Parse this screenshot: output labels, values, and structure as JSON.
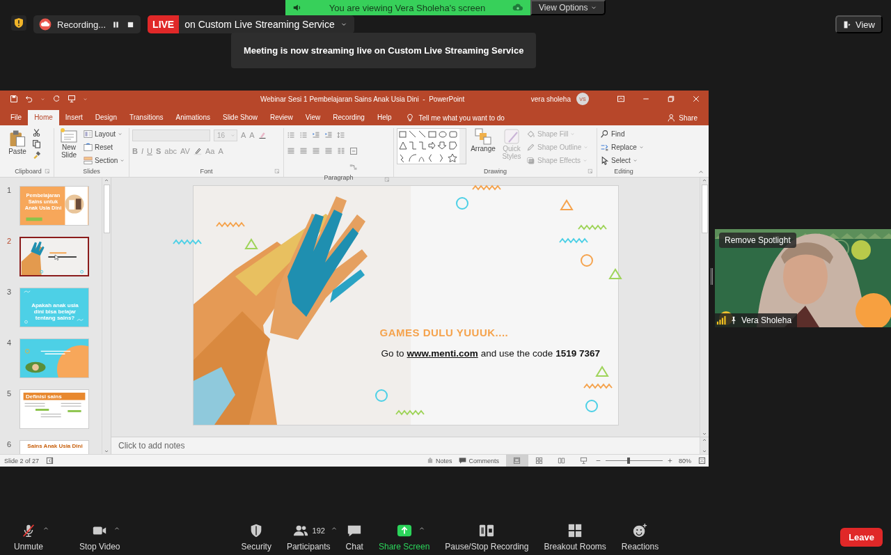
{
  "top_bar": {
    "recording": "Recording...",
    "live_badge": "LIVE",
    "live_service": "on Custom Live Streaming Service",
    "view_button": "View"
  },
  "share_banner": {
    "text": "You are viewing Vera Sholeha's screen",
    "view_options": "View Options"
  },
  "toast": "Meeting is now streaming live on Custom Live Streaming Service",
  "powerpoint": {
    "title": "Webinar Sesi 1 Pembelajaran Sains Anak Usia Dini  -  PowerPoint",
    "user_name": "vera sholeha",
    "user_initials": "VS",
    "tabs": [
      {
        "label": "File",
        "selected": false
      },
      {
        "label": "Home",
        "selected": true
      },
      {
        "label": "Insert",
        "selected": false
      },
      {
        "label": "Design",
        "selected": false
      },
      {
        "label": "Transitions",
        "selected": false
      },
      {
        "label": "Animations",
        "selected": false
      },
      {
        "label": "Slide Show",
        "selected": false
      },
      {
        "label": "Review",
        "selected": false
      },
      {
        "label": "View",
        "selected": false
      },
      {
        "label": "Recording",
        "selected": false
      },
      {
        "label": "Help",
        "selected": false
      }
    ],
    "tell_me": "Tell me what you want to do",
    "share": "Share",
    "ribbon": [
      {
        "kind": "clipboard",
        "label": "Clipboard",
        "paste": "Paste"
      },
      {
        "kind": "slides",
        "label": "Slides",
        "new_slide": "New Slide",
        "items": [
          "Layout",
          "Reset",
          "Section"
        ]
      },
      {
        "kind": "font",
        "label": "Font",
        "size": "16",
        "size_buttons": [
          "A",
          "A"
        ],
        "styles": [
          "B",
          "I",
          "U",
          "S",
          "abc",
          "AV",
          "Aa",
          "A"
        ]
      },
      {
        "kind": "paragraph",
        "label": "Paragraph"
      },
      {
        "kind": "drawing",
        "label": "Drawing",
        "arrange": "Arrange",
        "quick_styles": {
          "label": "Quick Styles",
          "disabled": true
        },
        "shape_items": [
          {
            "label": "Shape Fill",
            "disabled": true
          },
          {
            "label": "Shape Outline",
            "disabled": true
          },
          {
            "label": "Shape Effects",
            "disabled": true
          }
        ]
      },
      {
        "kind": "editing",
        "label": "Editing",
        "items": [
          "Find",
          "Replace",
          "Select"
        ]
      }
    ],
    "thumbnails": [
      {
        "number": "1",
        "kind": "orange",
        "title": "Pembelajaran Sains untuk Anak Usia Dini",
        "selected": false
      },
      {
        "number": "2",
        "kind": "hands",
        "selected": true
      },
      {
        "number": "3",
        "kind": "cyan",
        "title": "Apakah anak usia dini bisa belajar tentang sains?",
        "selected": false
      },
      {
        "number": "4",
        "kind": "cyan-orange",
        "selected": false
      },
      {
        "number": "5",
        "kind": "white-banner",
        "title": "Definisi sains",
        "selected": false
      },
      {
        "number": "6",
        "kind": "white",
        "title": "Sains Anak Usia Dini",
        "selected": false
      }
    ],
    "slide": {
      "heading": "GAMES DULU YUUUK....",
      "intro": "Go to",
      "link": "www.menti.com",
      "rest": "and use the code **1519 7367**"
    },
    "notes_placeholder": "Click to add notes",
    "status_bar": {
      "slide_position": "Slide 2 of 27",
      "notes": "Notes",
      "comments": "Comments",
      "views": [
        {
          "kind": "normal",
          "selected": true
        },
        {
          "kind": "sorter",
          "selected": false
        },
        {
          "kind": "reading",
          "selected": false
        },
        {
          "kind": "slideshow",
          "selected": false
        }
      ],
      "zoom_slider": {
        "level": 0.4
      },
      "zoom": "80%"
    }
  },
  "video_tile": {
    "spotlight_button": "Remove Spotlight",
    "name": "Vera Sholeha"
  },
  "toolbar": {
    "items": [
      {
        "kind": "mic",
        "label": "Unmute",
        "muted": true,
        "caret": true
      },
      {
        "kind": "video",
        "label": "Stop Video",
        "caret": true
      },
      {
        "kind": "security",
        "label": "Security",
        "caret": false
      },
      {
        "kind": "participants",
        "label": "Participants",
        "count": "192",
        "caret": true
      },
      {
        "kind": "chat",
        "label": "Chat",
        "caret": false
      },
      {
        "kind": "share",
        "label": "Share Screen",
        "caret": true
      },
      {
        "kind": "recording",
        "label": "Pause/Stop Recording",
        "caret": false
      },
      {
        "kind": "breakout",
        "label": "Breakout Rooms",
        "caret": false
      },
      {
        "kind": "reactions",
        "label": "Reactions",
        "caret": false
      }
    ],
    "leave": "Leave"
  }
}
